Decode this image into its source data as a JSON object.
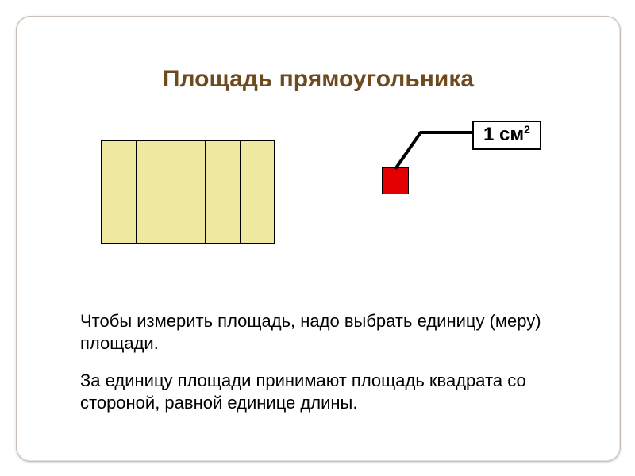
{
  "title": "Площадь прямоугольника",
  "unit_label_base": "1 см",
  "unit_label_exp": "2",
  "grid": {
    "rows": 3,
    "cols": 5
  },
  "paragraph1": "Чтобы измерить площадь, надо выбрать единицу (меру) площади.",
  "paragraph2": "За единицу площади принимают площадь квадрата со стороной, равной единице длины."
}
